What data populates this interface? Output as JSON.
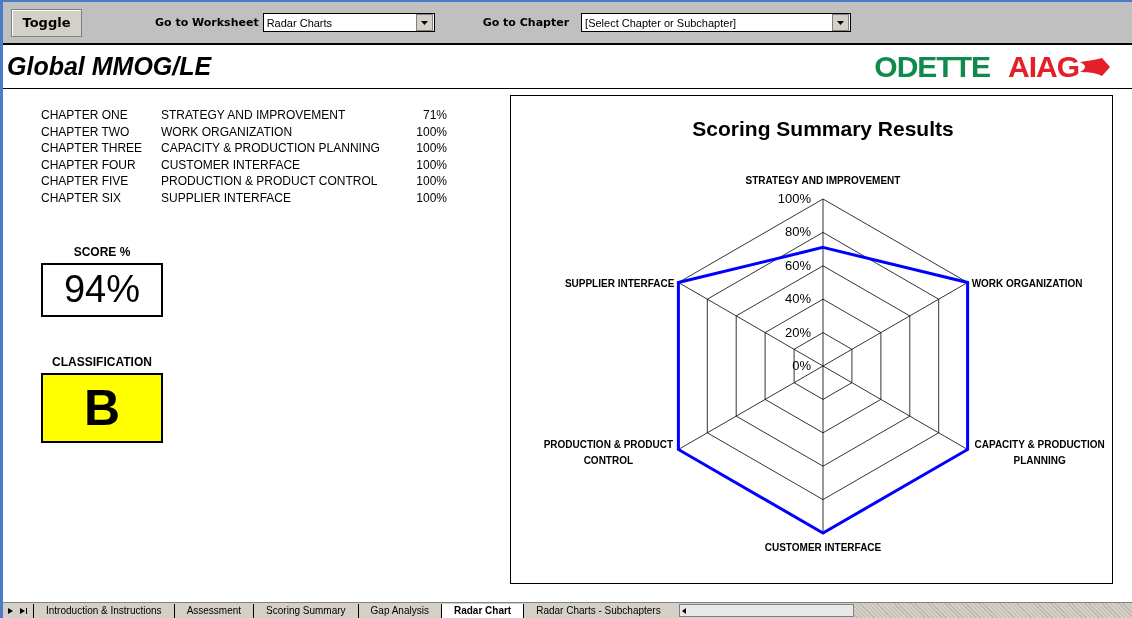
{
  "toolbar": {
    "toggle_button": "Toggle",
    "worksheet_label": "Go to Worksheet",
    "worksheet_value": "Radar Charts",
    "chapter_label": "Go to Chapter",
    "chapter_value": "[Select Chapter or Subchapter]"
  },
  "header": {
    "title": "Global MMOG/LE",
    "logos": [
      "ODETTE",
      "AIAG"
    ]
  },
  "chapters": [
    {
      "chapter": "CHAPTER ONE",
      "name": "STRATEGY AND IMPROVEMENT",
      "score": "71%"
    },
    {
      "chapter": "CHAPTER TWO",
      "name": "WORK ORGANIZATION",
      "score": "100%"
    },
    {
      "chapter": "CHAPTER THREE",
      "name": "CAPACITY & PRODUCTION PLANNING",
      "score": "100%"
    },
    {
      "chapter": "CHAPTER FOUR",
      "name": "CUSTOMER INTERFACE",
      "score": "100%"
    },
    {
      "chapter": "CHAPTER FIVE",
      "name": "PRODUCTION & PRODUCT CONTROL",
      "score": "100%"
    },
    {
      "chapter": "CHAPTER SIX",
      "name": "SUPPLIER INTERFACE",
      "score": "100%"
    }
  ],
  "score": {
    "label": "SCORE %",
    "value": "94%"
  },
  "classification": {
    "label": "CLASSIFICATION",
    "value": "B",
    "color": "#ffff00"
  },
  "radar_chart": {
    "title": "Scoring Summary Results",
    "axis_labels": [
      [
        "STRATEGY AND IMPROVEMENT"
      ],
      [
        "SUPPLIER INTERFACE"
      ],
      [
        "WORK ORGANIZATION"
      ],
      [
        "PRODUCTION & PRODUCT",
        "CONTROL"
      ],
      [
        "CAPACITY & PRODUCTION",
        "PLANNING"
      ],
      [
        "CUSTOMER INTERFACE"
      ]
    ],
    "ring_labels": [
      "100%",
      "80%",
      "60%",
      "40%",
      "20%",
      "0%"
    ]
  },
  "sheet_tabs": [
    {
      "label": "Introduction & Instructions",
      "selected": false
    },
    {
      "label": "Assessment",
      "selected": false
    },
    {
      "label": "Scoring Summary",
      "selected": false
    },
    {
      "label": "Gap Analysis",
      "selected": false
    },
    {
      "label": "Radar Chart",
      "selected": true
    },
    {
      "label": "Radar Charts - Subchapters",
      "selected": false
    }
  ]
}
